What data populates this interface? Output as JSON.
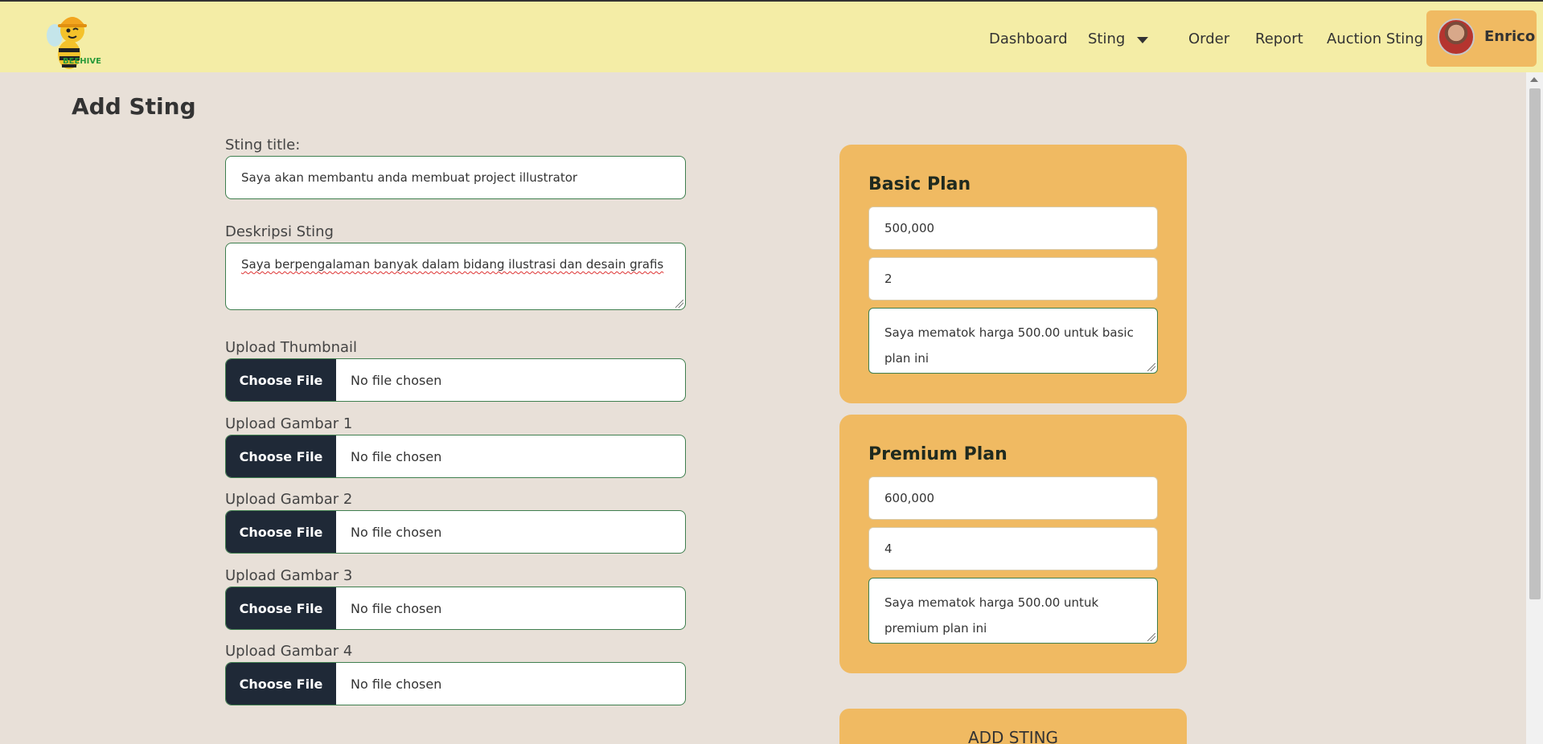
{
  "navbar": {
    "logo_text": "BEEHIVE",
    "items": [
      {
        "label": "Dashboard"
      },
      {
        "label": "Sting"
      },
      {
        "label": "Order"
      },
      {
        "label": "Report"
      },
      {
        "label": "Auction Sting"
      }
    ],
    "user": {
      "name": "Enrico"
    }
  },
  "page": {
    "title": "Add Sting"
  },
  "form": {
    "title_label": "Sting title:",
    "title_value": "Saya akan membantu anda membuat project illustrator",
    "desc_label": "Deskripsi Sting",
    "desc_value": "Saya berpengalaman banyak dalam bidang ilustrasi dan desain grafis",
    "uploads": [
      {
        "label": "Upload Thumbnail",
        "button": "Choose File",
        "status": "No file chosen"
      },
      {
        "label": "Upload Gambar 1",
        "button": "Choose File",
        "status": "No file chosen"
      },
      {
        "label": "Upload Gambar 2",
        "button": "Choose File",
        "status": "No file chosen"
      },
      {
        "label": "Upload Gambar 3",
        "button": "Choose File",
        "status": "No file chosen"
      },
      {
        "label": "Upload Gambar 4",
        "button": "Choose File",
        "status": "No file chosen"
      }
    ]
  },
  "plans": [
    {
      "title": "Basic Plan",
      "price": "500,000",
      "days": "2",
      "description": "Saya mematok harga 500.00 untuk basic plan ini"
    },
    {
      "title": "Premium Plan",
      "price": "600,000",
      "days": "4",
      "description": "Saya mematok harga 500.00 untuk premium plan ini"
    }
  ],
  "actions": {
    "submit_label": "ADD STING"
  },
  "colors": {
    "navbar": "#f4eda6",
    "page_bg": "#e8e0d8",
    "card": "#f0ba62",
    "file_button": "#1f2937",
    "input_border": "#3f7f4f"
  }
}
